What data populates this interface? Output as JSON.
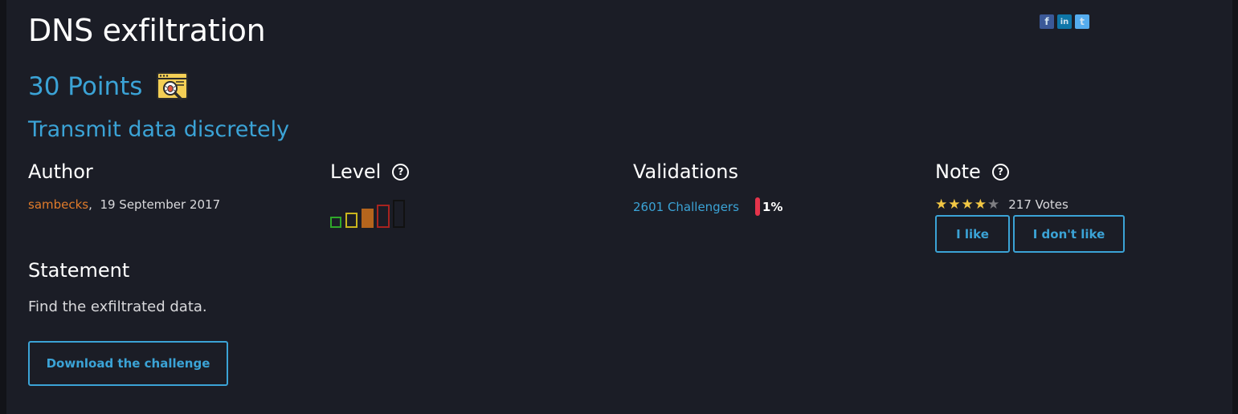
{
  "challenge": {
    "title": "DNS exfiltration",
    "points": "30 Points",
    "category_icon": "network-bug-inspect-icon",
    "subtitle": "Transmit data discretely"
  },
  "social": [
    {
      "icon": "facebook-icon",
      "glyph": "f",
      "color": "#3b5998"
    },
    {
      "icon": "linkedin-icon",
      "glyph": "in",
      "color": "#0e76a8"
    },
    {
      "icon": "twitter-icon",
      "glyph": "t",
      "color": "#55acee"
    }
  ],
  "author": {
    "heading": "Author",
    "name": "sambecks",
    "date": "19 September 2017"
  },
  "level": {
    "heading": "Level",
    "help": "?",
    "value": 3,
    "max": 5
  },
  "validations": {
    "heading": "Validations",
    "challengers": "2601 Challengers",
    "percent": "1%"
  },
  "note": {
    "heading": "Note",
    "help": "?",
    "rating": 4,
    "max": 5,
    "votes": "217 Votes",
    "like_label": "I like",
    "dislike_label": "I don't like"
  },
  "statement": {
    "heading": "Statement",
    "text": "Find the exfiltrated data.",
    "download_label": "Download the challenge"
  },
  "colors": {
    "accent": "#3ba3d6",
    "author": "#e07b2a",
    "level1": "#2fa82a",
    "level2": "#c9b51d",
    "level3": "#b5651d",
    "level4": "#a8231f",
    "level5": "#111111",
    "validation_bar": "#e5344b",
    "star_on": "#f2c744",
    "star_off": "#7e7e82"
  }
}
